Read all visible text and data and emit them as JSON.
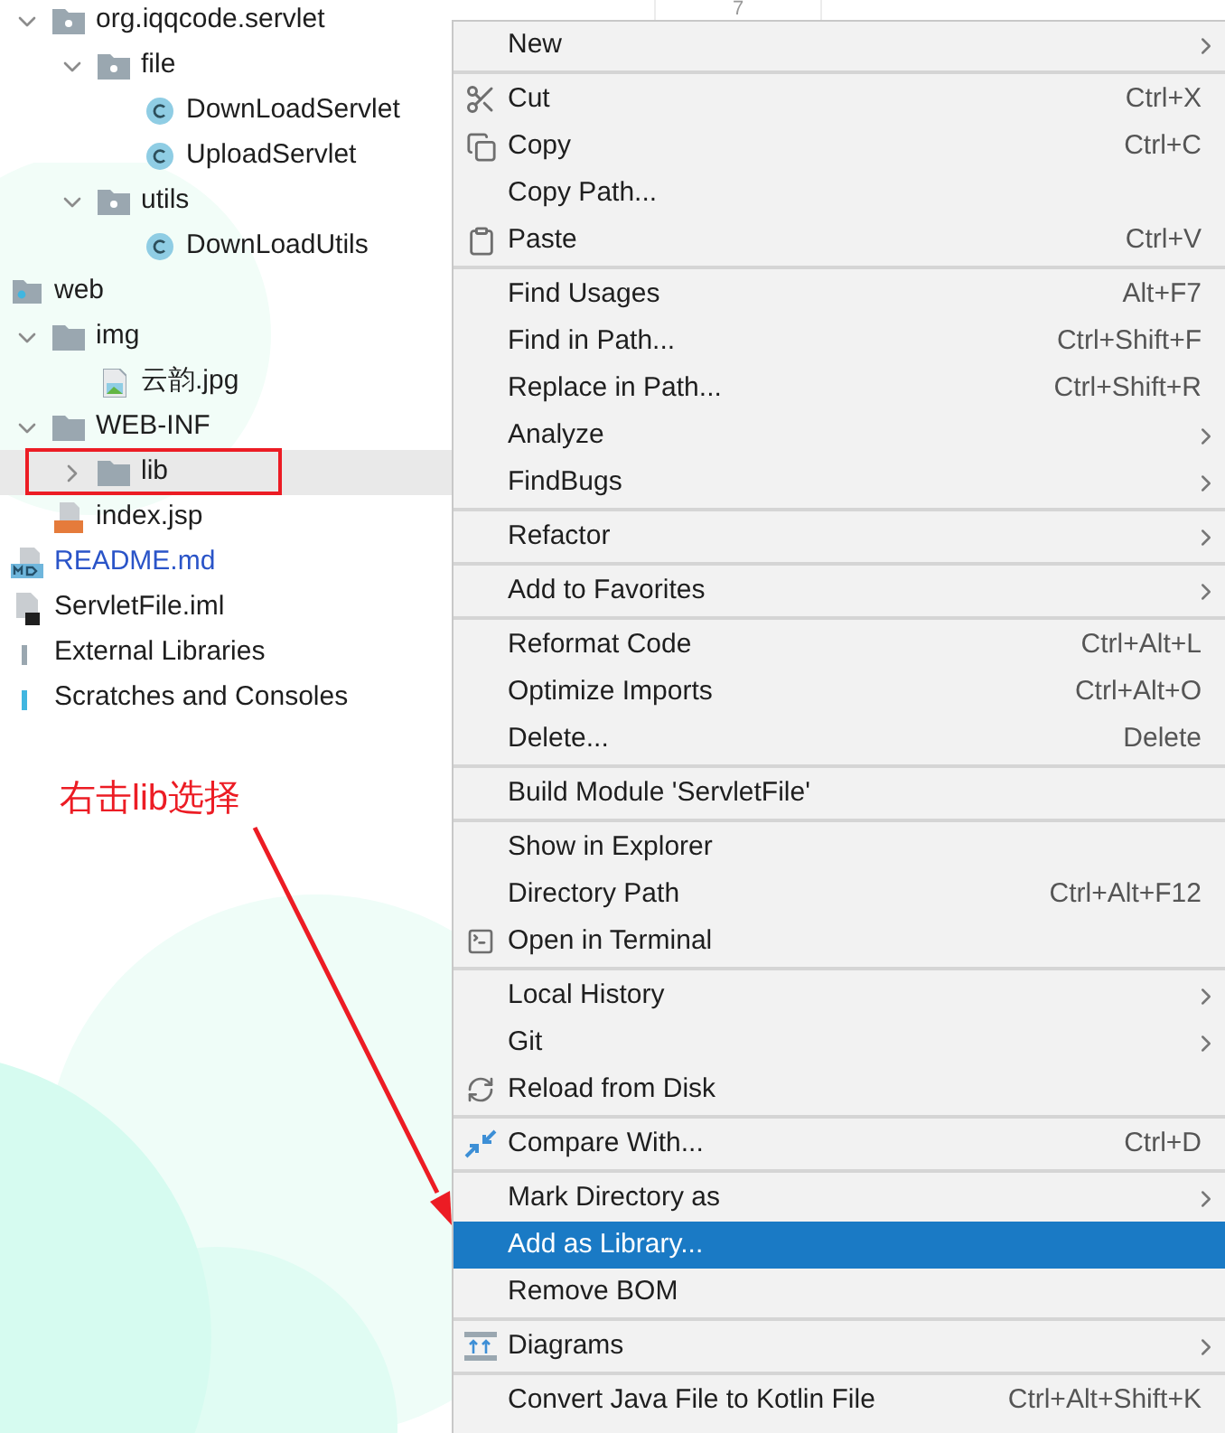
{
  "scrolled_branch": [
    {
      "label": "org.iqqcode.servlet",
      "kind": "package",
      "expanded": true,
      "children": [
        {
          "label": "file",
          "kind": "package",
          "expanded": true,
          "children": [
            {
              "label": "DownLoadServlet",
              "kind": "class"
            },
            {
              "label": "UploadServlet",
              "kind": "class"
            }
          ]
        },
        {
          "label": "utils",
          "kind": "package",
          "expanded": true,
          "children": [
            {
              "label": "DownLoadUtils",
              "kind": "class"
            }
          ]
        }
      ]
    }
  ],
  "tree": [
    {
      "label": "web",
      "kind": "web-folder",
      "children": [
        {
          "label": "img",
          "kind": "folder",
          "expanded": true,
          "selected": false,
          "children": [
            {
              "label": "云韵.jpg",
              "kind": "image"
            }
          ]
        },
        {
          "label": "WEB-INF",
          "kind": "folder",
          "expanded": true,
          "selected": false,
          "children": [
            {
              "label": "lib",
              "kind": "folder",
              "expanded": false,
              "selected": true
            }
          ]
        },
        {
          "label": "index.jsp",
          "kind": "jsp"
        }
      ]
    },
    {
      "label": "README.md",
      "kind": "markdown"
    },
    {
      "label": "ServletFile.iml",
      "kind": "module-file"
    },
    {
      "label": "External Libraries",
      "kind": "library"
    },
    {
      "label": "Scratches and Consoles",
      "kind": "scratch"
    }
  ],
  "editor": {
    "line_number": "7"
  },
  "menu": {
    "groups": [
      [
        {
          "label": "New",
          "submenu": true,
          "selected": false
        }
      ],
      [
        {
          "label": "Cut",
          "shortcut": "Ctrl+X",
          "selected": false
        },
        {
          "label": "Copy",
          "shortcut": "Ctrl+C",
          "selected": false
        },
        {
          "label": "Copy Path...",
          "selected": false
        },
        {
          "label": "Paste",
          "shortcut": "Ctrl+V",
          "selected": false
        }
      ],
      [
        {
          "label": "Find Usages",
          "shortcut": "Alt+F7",
          "selected": false
        },
        {
          "label": "Find in Path...",
          "shortcut": "Ctrl+Shift+F",
          "selected": false
        },
        {
          "label": "Replace in Path...",
          "shortcut": "Ctrl+Shift+R",
          "selected": false
        },
        {
          "label": "Analyze",
          "submenu": true,
          "selected": false
        },
        {
          "label": "FindBugs",
          "submenu": true,
          "selected": false
        }
      ],
      [
        {
          "label": "Refactor",
          "submenu": true,
          "selected": false
        }
      ],
      [
        {
          "label": "Add to Favorites",
          "submenu": true,
          "selected": false
        }
      ],
      [
        {
          "label": "Reformat Code",
          "shortcut": "Ctrl+Alt+L",
          "selected": false
        },
        {
          "label": "Optimize Imports",
          "shortcut": "Ctrl+Alt+O",
          "selected": false
        },
        {
          "label": "Delete...",
          "shortcut": "Delete",
          "selected": false
        }
      ],
      [
        {
          "label": "Build Module 'ServletFile'",
          "selected": false
        }
      ],
      [
        {
          "label": "Show in Explorer",
          "selected": false
        },
        {
          "label": "Directory Path",
          "shortcut": "Ctrl+Alt+F12",
          "selected": false
        },
        {
          "label": "Open in Terminal",
          "selected": false
        }
      ],
      [
        {
          "label": "Local History",
          "submenu": true,
          "selected": false
        },
        {
          "label": "Git",
          "submenu": true,
          "selected": false
        },
        {
          "label": "Reload from Disk",
          "selected": false
        }
      ],
      [
        {
          "label": "Compare With...",
          "shortcut": "Ctrl+D",
          "selected": false
        }
      ],
      [
        {
          "label": "Mark Directory as",
          "submenu": true,
          "selected": false
        },
        {
          "label": "Add as Library...",
          "selected": true
        },
        {
          "label": "Remove BOM",
          "selected": false
        }
      ],
      [
        {
          "label": "Diagrams",
          "submenu": true,
          "selected": false
        }
      ],
      [
        {
          "label": "Convert Java File to Kotlin File",
          "shortcut": "Ctrl+Alt+Shift+K",
          "selected": false
        }
      ]
    ]
  },
  "annotation": {
    "text": "右击lib选择"
  }
}
